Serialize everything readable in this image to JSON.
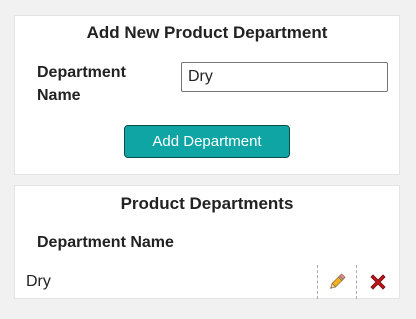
{
  "add_form": {
    "title": "Add New Product Department",
    "field_label": "Department Name",
    "field_value": "Dry",
    "submit_label": "Add Department"
  },
  "list": {
    "title": "Product Departments",
    "column_header": "Department Name",
    "rows": [
      {
        "name": "Dry",
        "edit_icon": "pencil-icon",
        "delete_icon": "delete-x-icon"
      }
    ]
  },
  "colors": {
    "accent": "#0fa5a5",
    "delete": "#c0151b",
    "pencil": "#f0b020"
  }
}
